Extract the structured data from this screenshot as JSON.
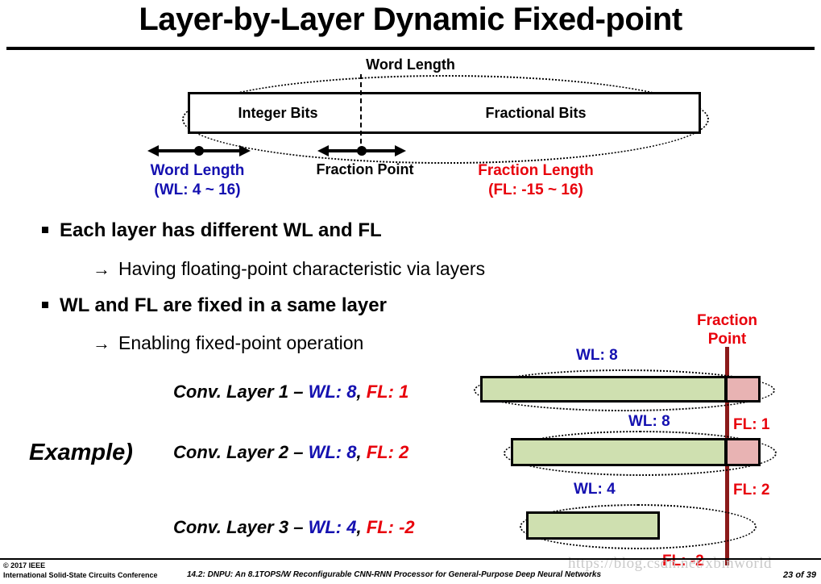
{
  "slide": {
    "title": "Layer-by-Layer Dynamic Fixed-point",
    "diagram": {
      "word_length_label": "Word Length",
      "integer_bits_label": "Integer Bits",
      "fractional_bits_label": "Fractional Bits",
      "word_length_caption_line1": "Word Length",
      "word_length_caption_line2": "(WL: 4 ~ 16)",
      "fraction_point_caption": "Fraction Point",
      "fraction_length_caption_line1": "Fraction Length",
      "fraction_length_caption_line2": "(FL: -15 ~ 16)"
    },
    "bullets": [
      {
        "text": "Each layer has different WL and FL"
      },
      {
        "text": "Having floating-point characteristic via layers",
        "arrow": "→"
      },
      {
        "text": "WL and FL are fixed in a same layer"
      },
      {
        "text": "Enabling fixed-point operation",
        "arrow": "→"
      }
    ],
    "example": {
      "label": "Example)",
      "layers": [
        {
          "name": "Conv. Layer 1",
          "dash": "–",
          "wl_label": "WL:",
          "wl_value": "8",
          "comma": ",",
          "fl_label": "FL:",
          "fl_value": "1"
        },
        {
          "name": "Conv. Layer 2",
          "dash": "–",
          "wl_label": "WL:",
          "wl_value": "8",
          "comma": ",",
          "fl_label": "FL:",
          "fl_value": "2"
        },
        {
          "name": "Conv. Layer 3",
          "dash": "–",
          "wl_label": "WL:",
          "wl_value": "4",
          "comma": ",",
          "fl_label": "FL:",
          "fl_value": "-2"
        }
      ]
    },
    "bars": {
      "fraction_point_line1": "Fraction",
      "fraction_point_line2": "Point",
      "labels": [
        {
          "wl": "WL: 8",
          "fl": "FL: 1"
        },
        {
          "wl": "WL: 8",
          "fl": "FL: 2"
        },
        {
          "wl": "WL: 4",
          "fl": "FL: -2"
        }
      ]
    },
    "footer": {
      "copyright_line1": "© 2017 IEEE",
      "copyright_line2": "International Solid-State Circuits Conference",
      "center": "14.2: DNPU: An 8.1TOPS/W Reconfigurable CNN-RNN Processor for General-Purpose Deep Neural Networks",
      "page": "23 of 39",
      "watermark": "https://blog.csdn.net/xbinworld"
    }
  },
  "colors": {
    "blue": "#1410b0",
    "red": "#e8000b",
    "green_bar": "#cfe0b0",
    "pink_bar": "#e8b3b3",
    "fp_line": "#8b1a1a"
  }
}
